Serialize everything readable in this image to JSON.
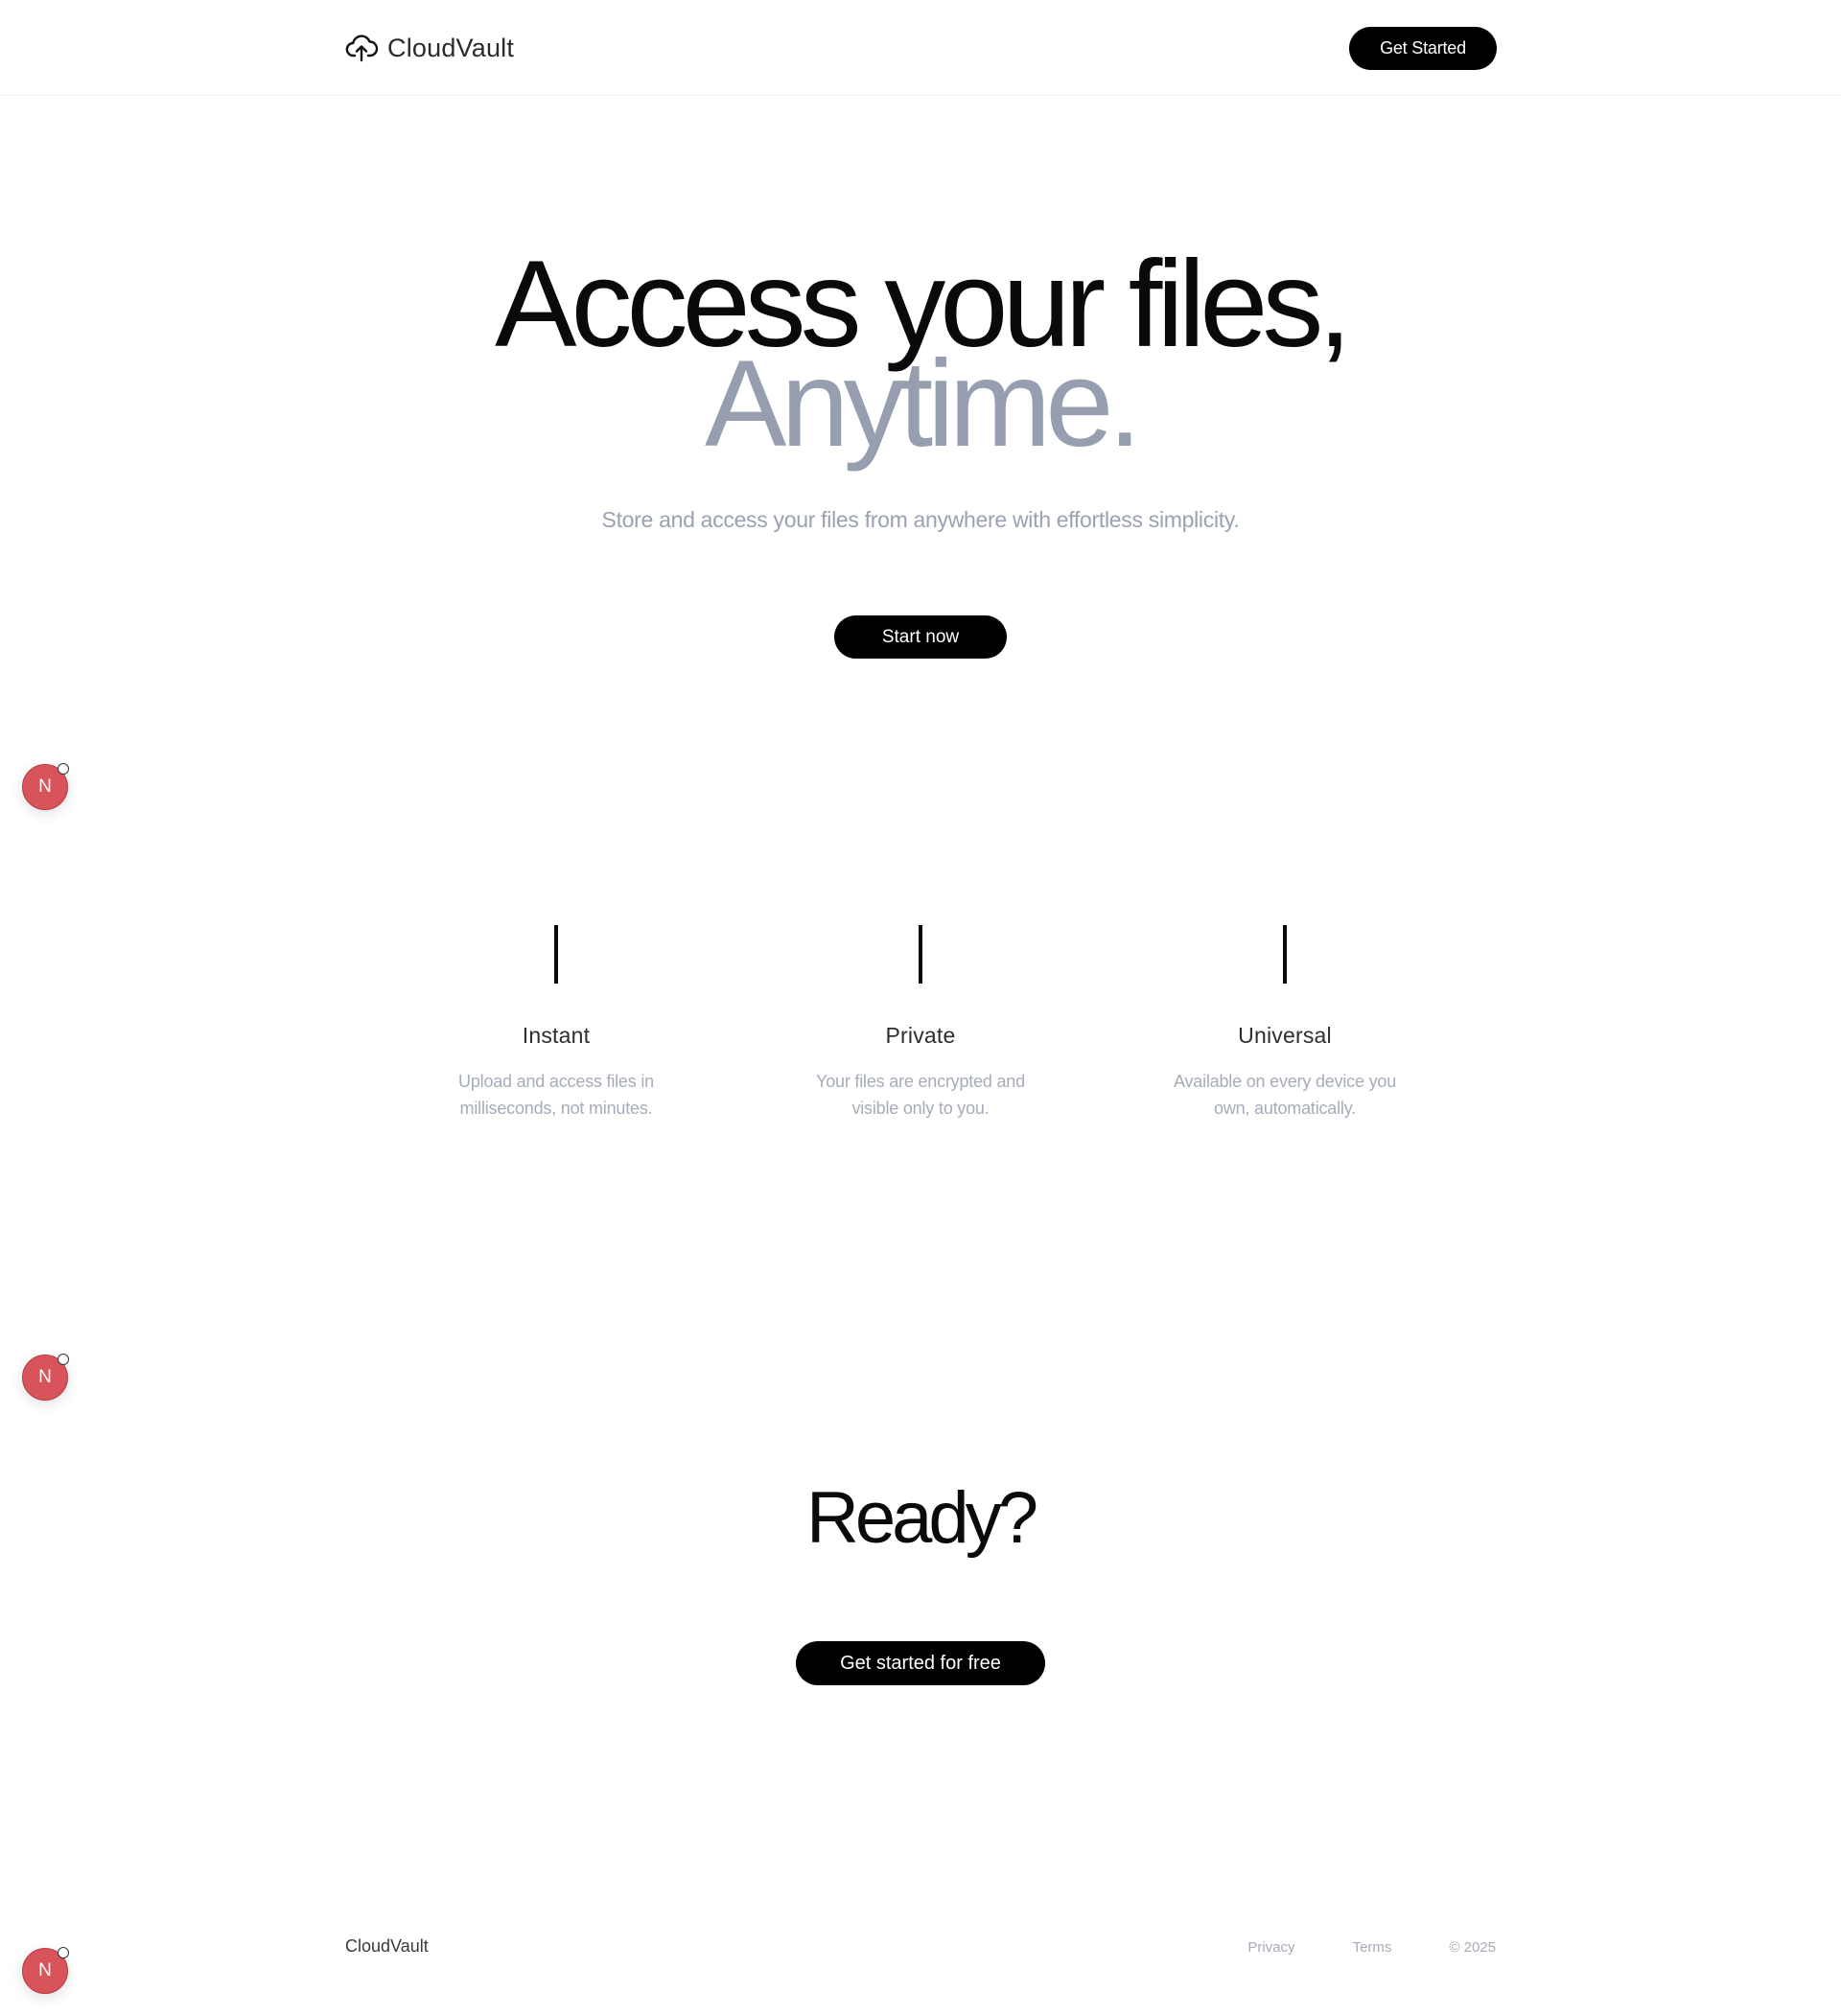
{
  "header": {
    "brand": "CloudVault",
    "brand_icon": "cloud-upload-icon",
    "cta_label": "Get Started"
  },
  "hero": {
    "title_line1": "Access your files,",
    "title_line2": "Anytime.",
    "subtitle": "Store and access your files from anywhere with effortless simplicity.",
    "cta_label": "Start now",
    "accent_color": "#969eaf"
  },
  "features": [
    {
      "title": "Instant",
      "description": "Upload and access files in milliseconds, not minutes."
    },
    {
      "title": "Private",
      "description": "Your files are encrypted and visible only to you."
    },
    {
      "title": "Universal",
      "description": "Available on every device you own, automatically."
    }
  ],
  "cta": {
    "title": "Ready?",
    "button_label": "Get started for free"
  },
  "footer": {
    "brand": "CloudVault",
    "links": [
      "Privacy",
      "Terms"
    ],
    "copyright": "© 2025"
  },
  "floating_badges": [
    {
      "label": "N",
      "color": "#d9535a"
    },
    {
      "label": "N",
      "color": "#d9535a"
    },
    {
      "label": "N",
      "color": "#d9535a"
    }
  ]
}
